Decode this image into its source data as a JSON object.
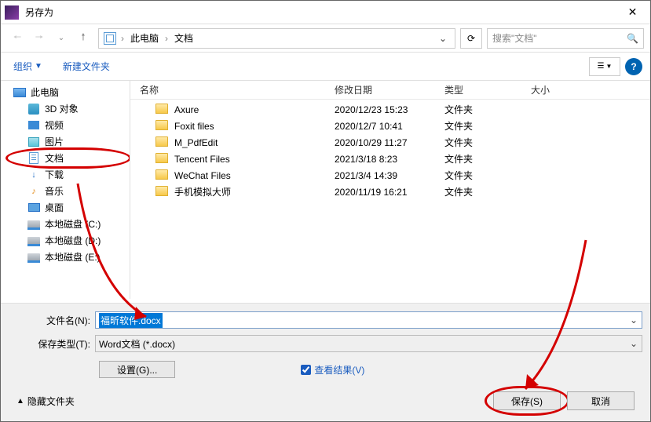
{
  "window": {
    "title": "另存为"
  },
  "nav": {
    "crumb1": "此电脑",
    "crumb2": "文档",
    "search_placeholder": "搜索\"文档\""
  },
  "toolbar": {
    "organize": "组织",
    "newfolder": "新建文件夹"
  },
  "tree": {
    "pc": "此电脑",
    "threeD": "3D 对象",
    "video": "视频",
    "pictures": "图片",
    "documents": "文档",
    "downloads": "下载",
    "music": "音乐",
    "desktop": "桌面",
    "driveC": "本地磁盘 (C:)",
    "driveD": "本地磁盘 (D:)",
    "driveE": "本地磁盘 (E:)"
  },
  "columns": {
    "name": "名称",
    "date": "修改日期",
    "type": "类型",
    "size": "大小"
  },
  "files": [
    {
      "name": "Axure",
      "date": "2020/12/23 15:23",
      "type": "文件夹"
    },
    {
      "name": "Foxit files",
      "date": "2020/12/7 10:41",
      "type": "文件夹"
    },
    {
      "name": "M_PdfEdit",
      "date": "2020/10/29 11:27",
      "type": "文件夹"
    },
    {
      "name": "Tencent Files",
      "date": "2021/3/18 8:23",
      "type": "文件夹"
    },
    {
      "name": "WeChat Files",
      "date": "2021/3/4 14:39",
      "type": "文件夹"
    },
    {
      "name": "手机模拟大师",
      "date": "2020/11/19 16:21",
      "type": "文件夹"
    }
  ],
  "form": {
    "filename_label": "文件名(N):",
    "filename_value": "福昕软件.docx",
    "filetype_label": "保存类型(T):",
    "filetype_value": "Word文档 (*.docx)",
    "settings": "设置(G)...",
    "viewresult": "查看结果(V)"
  },
  "footer": {
    "hide": "隐藏文件夹",
    "save": "保存(S)",
    "cancel": "取消"
  }
}
